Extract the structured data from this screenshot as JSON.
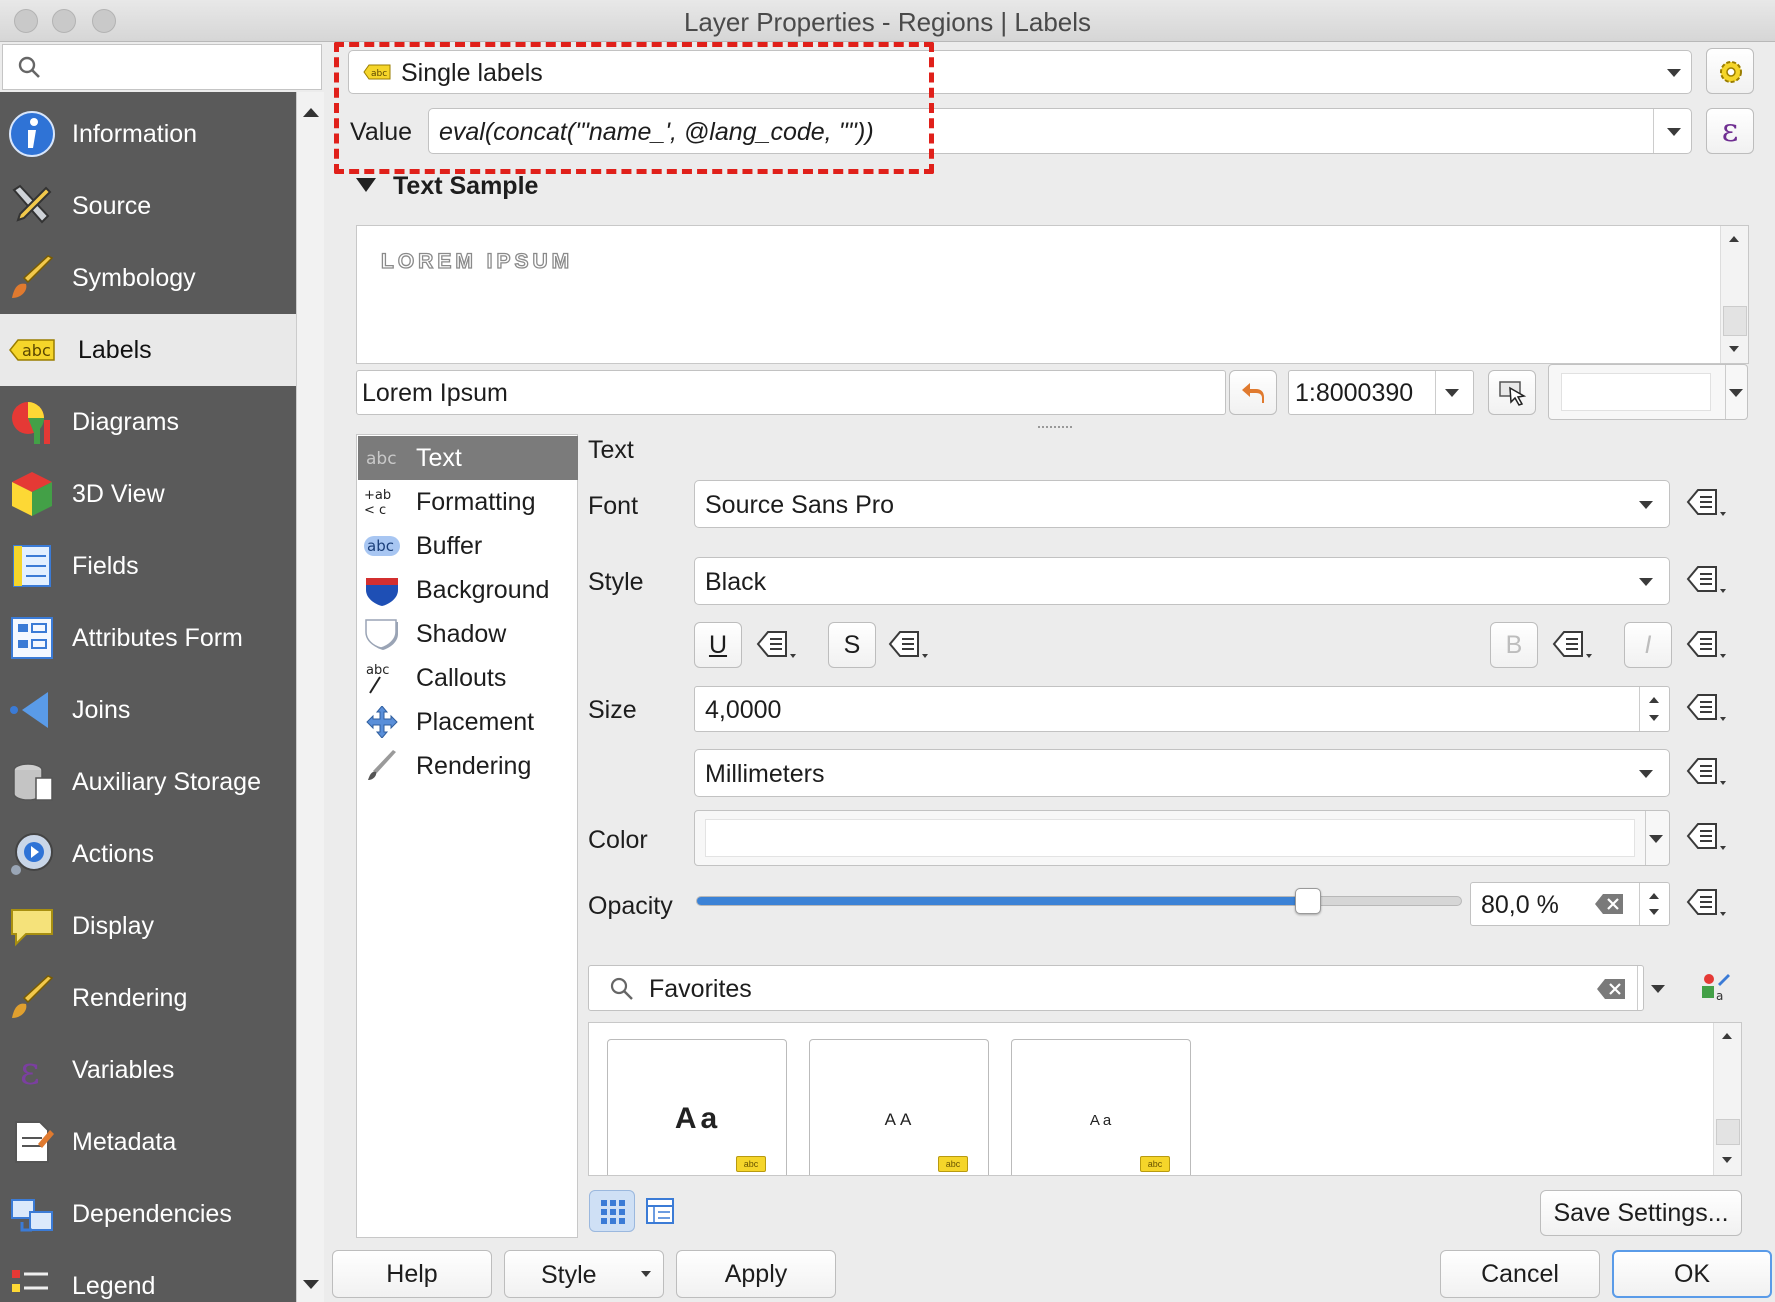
{
  "window": {
    "title": "Layer Properties - Regions | Labels"
  },
  "sidebar": {
    "search_placeholder": "",
    "items": [
      {
        "label": "Information",
        "icon": "info-icon"
      },
      {
        "label": "Source",
        "icon": "source-tools-icon"
      },
      {
        "label": "Symbology",
        "icon": "paintbrush-icon"
      },
      {
        "label": "Labels",
        "icon": "abc-label-icon",
        "active": true
      },
      {
        "label": "Diagrams",
        "icon": "diagram-icon"
      },
      {
        "label": "3D View",
        "icon": "cube-icon"
      },
      {
        "label": "Fields",
        "icon": "fields-icon"
      },
      {
        "label": "Attributes Form",
        "icon": "form-icon"
      },
      {
        "label": "Joins",
        "icon": "joins-icon"
      },
      {
        "label": "Auxiliary Storage",
        "icon": "database-icon"
      },
      {
        "label": "Actions",
        "icon": "actions-gear-icon"
      },
      {
        "label": "Display",
        "icon": "speech-bubble-icon"
      },
      {
        "label": "Rendering",
        "icon": "rendering-brush-icon"
      },
      {
        "label": "Variables",
        "icon": "epsilon-icon"
      },
      {
        "label": "Metadata",
        "icon": "metadata-icon"
      },
      {
        "label": "Dependencies",
        "icon": "dependencies-icon"
      },
      {
        "label": "Legend",
        "icon": "legend-icon"
      }
    ]
  },
  "labeling": {
    "mode": "Single labels",
    "value_label": "Value",
    "value_expression": "eval(concat('\"name_', @lang_code, '\"'))",
    "epsilon": "ε"
  },
  "text_sample": {
    "section_title": "Text Sample",
    "preview_text": "LOREM IPSUM",
    "sample_input": "Lorem Ipsum",
    "scale": "1:8000390"
  },
  "tabs": [
    {
      "label": "Text",
      "icon": "abc-text-icon",
      "active": true
    },
    {
      "label": "Formatting",
      "icon": "formatting-icon"
    },
    {
      "label": "Buffer",
      "icon": "buffer-icon"
    },
    {
      "label": "Background",
      "icon": "background-shield-icon"
    },
    {
      "label": "Shadow",
      "icon": "shadow-icon"
    },
    {
      "label": "Callouts",
      "icon": "callouts-icon"
    },
    {
      "label": "Placement",
      "icon": "placement-icon"
    },
    {
      "label": "Rendering",
      "icon": "rendering-icon"
    }
  ],
  "text_panel": {
    "heading": "Text",
    "font_label": "Font",
    "font_value": "Source Sans Pro",
    "style_label": "Style",
    "style_value": "Black",
    "underline": "U",
    "strike": "S",
    "bold": "B",
    "italic": "I",
    "size_label": "Size",
    "size_value": "4,0000",
    "unit_value": "Millimeters",
    "color_label": "Color",
    "opacity_label": "Opacity",
    "opacity_value": "80,0 %",
    "opacity_fraction": 0.8
  },
  "styles": {
    "filter_value": "Favorites",
    "tiles": [
      {
        "sample": "Aa",
        "tag": "abc"
      },
      {
        "sample": "AA",
        "tag": "abc"
      },
      {
        "sample": "Aa",
        "tag": "abc"
      }
    ],
    "save_settings": "Save Settings..."
  },
  "footer": {
    "help": "Help",
    "style": "Style",
    "apply": "Apply",
    "cancel": "Cancel",
    "ok": "OK"
  },
  "colors": {
    "accent": "#3b82d6",
    "highlight": "#e0201a",
    "sidebar": "#5a5a5a"
  }
}
